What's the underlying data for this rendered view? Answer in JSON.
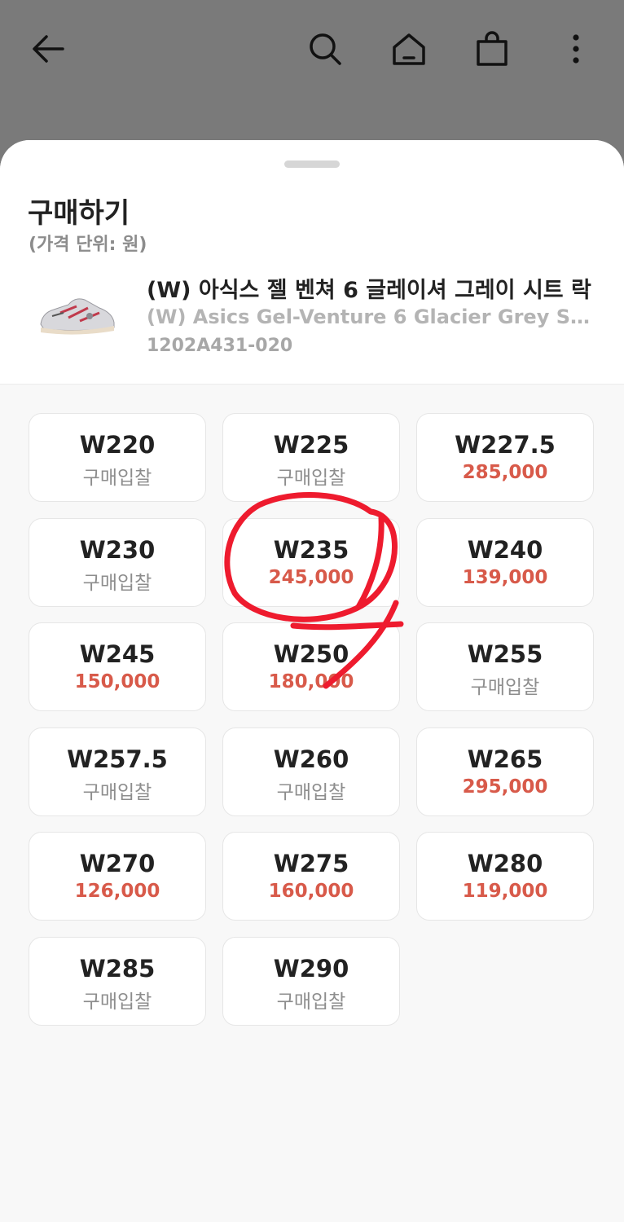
{
  "colors": {
    "dim_overlay": "#7a7a7a",
    "price_red": "#d85a4a",
    "label_gray": "#8d8d8d",
    "annotation_red": "#ee1b2e"
  },
  "header": {
    "icons": [
      "back-arrow-icon",
      "search-icon",
      "home-icon",
      "shopping-bag-icon",
      "more-vertical-icon"
    ]
  },
  "sheet": {
    "title": "구매하기",
    "subtitle": "(가격 단위: 원)"
  },
  "product": {
    "name_ko": "(W) 아식스 젤 벤쳐 6 글레이셔 그레이 시트 락",
    "name_en": "(W) Asics Gel-Venture 6 Glacier Grey Sh...",
    "code": "1202A431-020"
  },
  "sizes": [
    {
      "size": "W220",
      "price": "구매입찰",
      "has_price": false
    },
    {
      "size": "W225",
      "price": "구매입찰",
      "has_price": false
    },
    {
      "size": "W227.5",
      "price": "285,000",
      "has_price": true
    },
    {
      "size": "W230",
      "price": "구매입찰",
      "has_price": false
    },
    {
      "size": "W235",
      "price": "245,000",
      "has_price": true
    },
    {
      "size": "W240",
      "price": "139,000",
      "has_price": true
    },
    {
      "size": "W245",
      "price": "150,000",
      "has_price": true
    },
    {
      "size": "W250",
      "price": "180,000",
      "has_price": true
    },
    {
      "size": "W255",
      "price": "구매입찰",
      "has_price": false
    },
    {
      "size": "W257.5",
      "price": "구매입찰",
      "has_price": false
    },
    {
      "size": "W260",
      "price": "구매입찰",
      "has_price": false
    },
    {
      "size": "W265",
      "price": "295,000",
      "has_price": true
    },
    {
      "size": "W270",
      "price": "126,000",
      "has_price": true
    },
    {
      "size": "W275",
      "price": "160,000",
      "has_price": true
    },
    {
      "size": "W280",
      "price": "119,000",
      "has_price": true
    },
    {
      "size": "W285",
      "price": "구매입찰",
      "has_price": false
    },
    {
      "size": "W290",
      "price": "구매입찰",
      "has_price": false
    }
  ]
}
